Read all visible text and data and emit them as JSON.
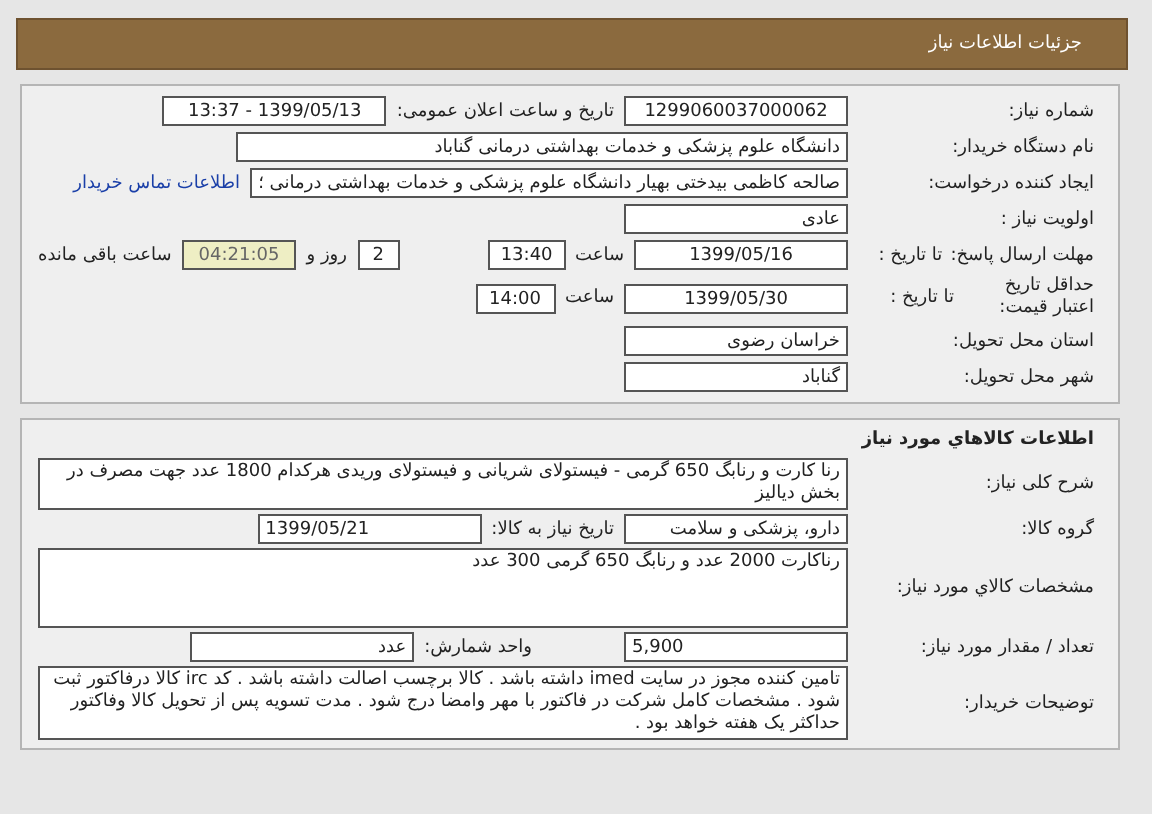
{
  "header": {
    "title": "جزئیات اطلاعات نیاز"
  },
  "details": {
    "need_number": {
      "label": "شماره نیاز:",
      "value": "1299060037000062"
    },
    "announce": {
      "label": "تاریخ و ساعت اعلان عمومی:",
      "value": "1399/05/13 - 13:37"
    },
    "buyer": {
      "label": "نام دستگاه خریدار:",
      "value": "دانشگاه علوم پزشکی و خدمات بهداشتی درمانی گناباد"
    },
    "requester": {
      "label": "ایجاد کننده درخواست:",
      "value": "صالحه کاظمی بیدختی بهیار دانشگاه علوم پزشکی و خدمات بهداشتی درمانی ؛",
      "link": "اطلاعات تماس خریدار"
    },
    "priority": {
      "label": "اولویت نیاز :",
      "value": "عادی"
    },
    "deadline": {
      "label": "مهلت ارسال پاسخ:",
      "date_label": "تا تاریخ :",
      "date": "1399/05/16",
      "time_label": "ساعت",
      "time": "13:40",
      "days": "2",
      "days_label": "روز و",
      "remaining": "04:21:05",
      "remaining_label": "ساعت باقی مانده"
    },
    "validity": {
      "label": "حداقل تاریخ اعتبار قیمت:",
      "date_label": "تا تاریخ :",
      "date": "1399/05/30",
      "time_label": "ساعت",
      "time": "14:00"
    },
    "province": {
      "label": "استان محل تحویل:",
      "value": "خراسان رضوی"
    },
    "city": {
      "label": "شهر محل تحویل:",
      "value": "گناباد"
    }
  },
  "goods": {
    "title": "اطلاعات کالاهاي مورد نیاز",
    "description": {
      "label": "شرح کلی نیاز:",
      "value": "رنا کارت و رنابگ 650 گرمی - فیستولای شریانی و فیستولای وریدی هرکدام 1800 عدد جهت مصرف در بخش دیالیز"
    },
    "group": {
      "label": "گروه کالا:",
      "value": "دارو، پزشکی و سلامت",
      "date_label": "تاریخ نیاز به کالا:",
      "date": "1399/05/21"
    },
    "specs": {
      "label": "مشخصات کالاي مورد نیاز:",
      "value": "رناکارت 2000 عدد و رنابگ 650 گرمی 300 عدد"
    },
    "quantity": {
      "label": "تعداد / مقدار مورد نیاز:",
      "value": "5,900",
      "unit_label": "واحد شمارش:",
      "unit": "عدد"
    },
    "notes": {
      "label": "توضیحات خریدار:",
      "value": "تامین کننده مجوز در سایت imed داشته باشد . کالا برچسب اصالت داشته باشد . کد irc کالا درفاکتور ثبت شود . مشخصات کامل شرکت در فاکتور با مهر وامضا درج شود . مدت تسویه پس از تحویل کالا وفاکتور حداکثر یک هفته خواهد بود ."
    }
  }
}
